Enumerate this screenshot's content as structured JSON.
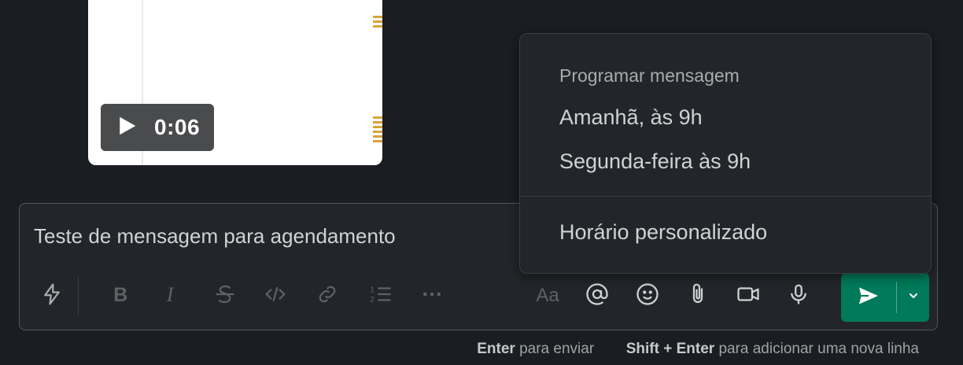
{
  "video": {
    "duration": "0:06",
    "play_icon": "play-icon"
  },
  "composer": {
    "message_text": "Teste de mensagem para agendamento",
    "toolbar": {
      "shortcuts_icon": "lightning-icon",
      "bold_icon": "bold-icon",
      "italic_icon": "italic-icon",
      "strikethrough_icon": "strikethrough-icon",
      "code_icon": "code-icon",
      "link_icon": "link-icon",
      "ordered_list_icon": "ordered-list-icon",
      "more_icon": "more-icon",
      "formatting_label": "Aa",
      "mention_label": "@",
      "emoji_icon": "emoji-icon",
      "attach_icon": "paperclip-icon",
      "video_icon": "video-camera-icon",
      "audio_icon": "microphone-icon"
    },
    "send_icon": "send-icon",
    "send_options_icon": "chevron-down-icon",
    "send_color": "#007a5a"
  },
  "hint": {
    "enter_key": "Enter",
    "enter_text": "para enviar",
    "shift_enter_key": "Shift + Enter",
    "shift_enter_text": "para adicionar uma nova linha"
  },
  "schedule_menu": {
    "title": "Programar mensagem",
    "options": [
      {
        "label": "Amanhã, às 9h"
      },
      {
        "label": "Segunda-feira às 9h"
      }
    ],
    "custom_label": "Horário personalizado"
  }
}
